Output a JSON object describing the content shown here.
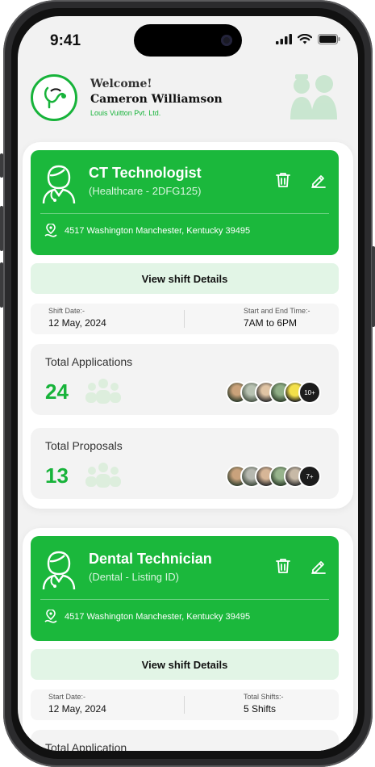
{
  "status": {
    "time": "9:41"
  },
  "header": {
    "welcome": "Welcome!",
    "name": "Cameron Williamson",
    "company": "Louis Vuitton Pvt. Ltd."
  },
  "cards": [
    {
      "title": "CT Technologist",
      "subtitle": "(Healthcare - 2DFG125)",
      "address": "4517 Washington Manchester, Kentucky 39495",
      "view_label": "View shift Details",
      "left_label": "Shift Date:-",
      "left_value": "12 May, 2024",
      "right_label": "Start and End Time:-",
      "right_value": "7AM to 6PM",
      "stats": [
        {
          "label": "Total Applications",
          "count": "24",
          "more": "10+"
        },
        {
          "label": "Total Proposals",
          "count": "13",
          "more": "7+"
        }
      ]
    },
    {
      "title": "Dental Technician",
      "subtitle": "(Dental - Listing ID)",
      "address": "4517 Washington Manchester, Kentucky 39495",
      "view_label": "View shift Details",
      "left_label": "Start Date:-",
      "left_value": "12 May, 2024",
      "right_label": "Total Shifts:-",
      "right_value": "5 Shifts",
      "stats": [
        {
          "label": "Total Application"
        }
      ]
    }
  ],
  "colors": {
    "accent": "#1bb83c",
    "accent_light": "#e2f5e6",
    "count": "#17b33a"
  },
  "icons": {
    "logo": "stethoscope-logo-icon",
    "header_art": "doctors-icon",
    "job": "nurse-avatar-icon",
    "delete": "trash-icon",
    "edit": "pencil-icon",
    "location": "map-pin-icon",
    "group": "people-group-icon"
  }
}
